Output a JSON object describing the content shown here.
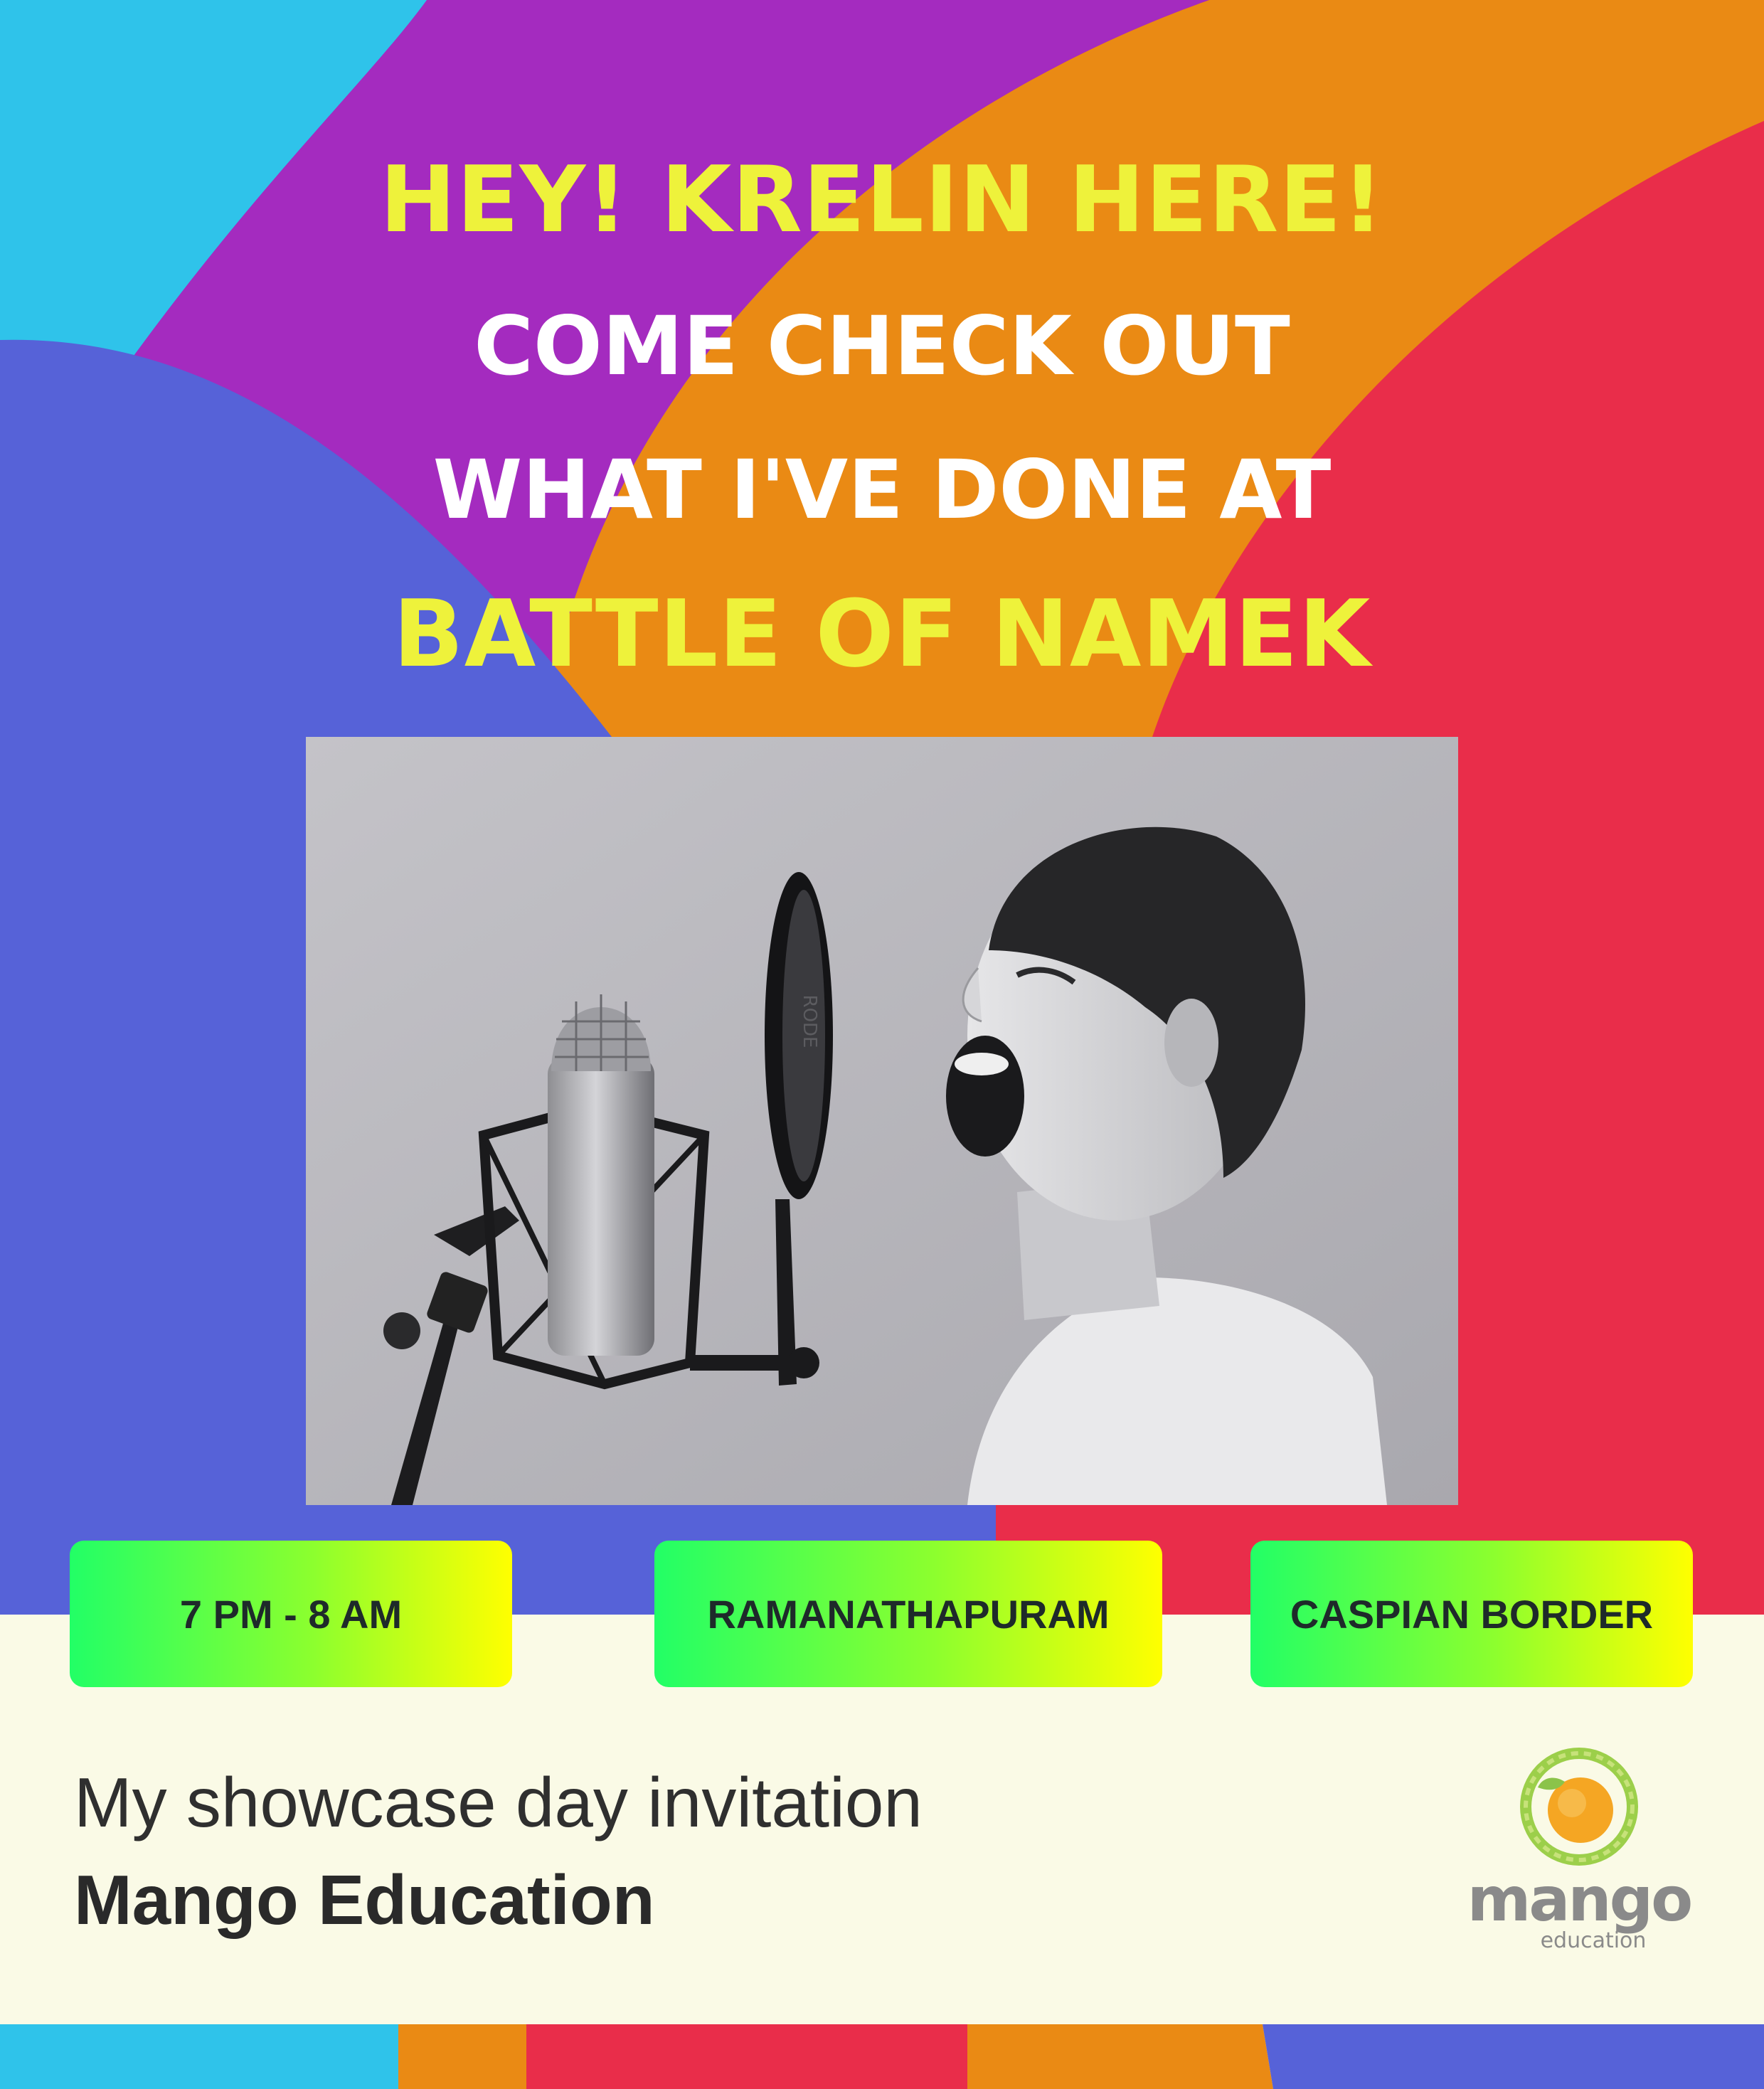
{
  "colors": {
    "cyan": "#2fc3ea",
    "purple": "#a42bbf",
    "orange": "#ea8a14",
    "red": "#e92d4a",
    "blue": "#5662d8",
    "cream": "#fafae6",
    "yellow_text": "#eef23b",
    "white_text": "#ffffff",
    "pill_gradient": [
      "#22ff66",
      "#ffff00"
    ]
  },
  "headline": {
    "line1": "HEY! KRELIN HERE!",
    "line2": "COME CHECK OUT",
    "line3": "WHAT I'VE DONE AT",
    "line4": "BATTLE OF NAMEK"
  },
  "photo": {
    "subject": "boy shouting into studio microphone (black and white)",
    "mic_brand": "RODE"
  },
  "details": {
    "time": "7 PM - 8 AM",
    "venue": "RAMANATHAPURAM",
    "location": "CASPIAN BORDER"
  },
  "footer": {
    "subtitle": "My showcase day invitation",
    "organization": "Mango Education"
  },
  "logo": {
    "name": "mango",
    "tagline": "education",
    "icon": "mango-fruit-icon"
  }
}
